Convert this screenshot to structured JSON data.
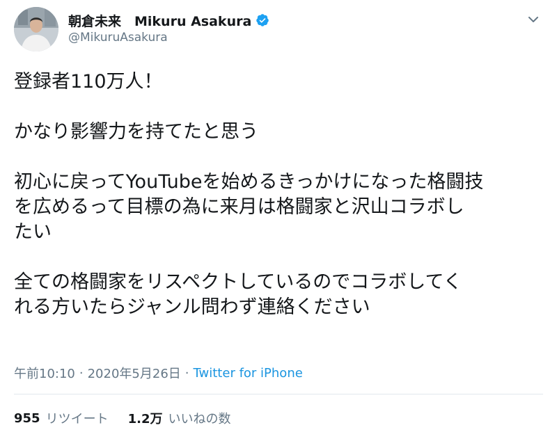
{
  "user": {
    "display_name": "朝倉未来　Mikuru Asakura",
    "handle": "@MikuruAsakura",
    "verified_icon": "verified-badge-icon",
    "accent": "#1da1f2"
  },
  "tweet": {
    "lines": [
      "登録者110万人！",
      "",
      "かなり影響力を持てたと思う",
      "",
      "初心に戻ってYouTubeを始めるきっかけになった格闘技",
      "を広めるって目標の為に来月は格闘家と沢山コラボし",
      "たい",
      "",
      "全ての格闘家をリスペクトしているのでコラボしてく",
      "れる方いたらジャンル問わず連絡ください"
    ]
  },
  "meta": {
    "time": "午前10:10",
    "separator": "·",
    "date": "2020年5月26日",
    "source": "Twitter for iPhone"
  },
  "stats": {
    "retweets_count": "955",
    "retweets_label": "リツイート",
    "likes_count": "1.2万",
    "likes_label": "いいねの数"
  },
  "colors": {
    "text": "#14171a",
    "secondary": "#657786",
    "link": "#1b95e0",
    "divider": "#e1e8ed"
  }
}
